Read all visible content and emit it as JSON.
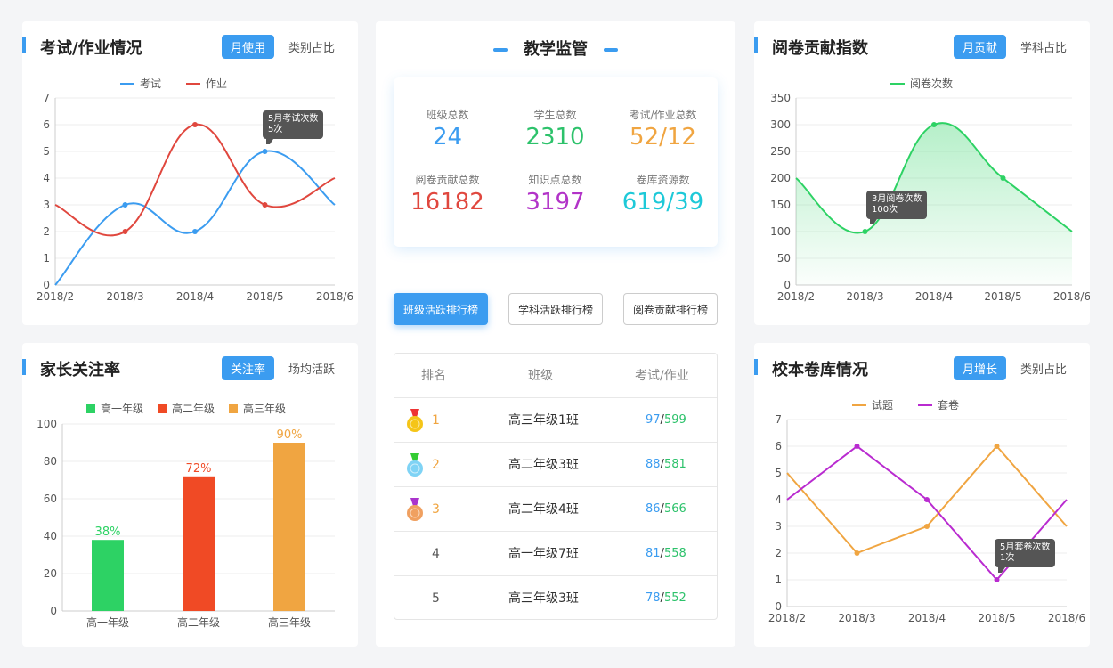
{
  "exam_card": {
    "title": "考试/作业情况",
    "tabs": [
      "月使用",
      "类别占比"
    ],
    "legend": [
      "考试",
      "作业"
    ],
    "colors": [
      "#3b9cf0",
      "#e0473e"
    ],
    "tooltip": [
      "5月考试次数",
      "5次"
    ],
    "chart_data": {
      "type": "line",
      "categories": [
        "2018/2",
        "2018/3",
        "2018/4",
        "2018/5",
        "2018/6"
      ],
      "y_ticks": [
        "0",
        "1",
        "2",
        "3",
        "4",
        "5",
        "6",
        "7"
      ],
      "ylim": [
        0,
        7
      ],
      "series": [
        {
          "name": "考试",
          "values": [
            0,
            3,
            2,
            5,
            3
          ]
        },
        {
          "name": "作业",
          "values": [
            3,
            2,
            6,
            3,
            4
          ]
        }
      ]
    }
  },
  "parent_card": {
    "title": "家长关注率",
    "tabs": [
      "关注率",
      "场均活跃"
    ],
    "legend": [
      "高一年级",
      "高二年级",
      "高三年级"
    ],
    "colors": [
      "#2dd264",
      "#f04a25",
      "#f0a541"
    ],
    "chart_data": {
      "type": "bar",
      "categories": [
        "高一年级",
        "高二年级",
        "高三年级"
      ],
      "values": [
        38,
        72,
        90
      ],
      "labels": [
        "38%",
        "72%",
        "90%"
      ],
      "y_ticks": [
        "0",
        "20",
        "40",
        "60",
        "80",
        "100"
      ],
      "ylim": [
        0,
        100
      ]
    }
  },
  "center": {
    "title": "教学监管",
    "stats": [
      {
        "label": "班级总数",
        "value": "24",
        "color": "#3b9cf0"
      },
      {
        "label": "学生总数",
        "value": "2310",
        "color": "#2dc26b"
      },
      {
        "label": "考试/作业总数",
        "value": "52/12",
        "color": "#f0a541"
      },
      {
        "label": "阅卷贡献总数",
        "value": "16182",
        "color": "#e0473e"
      },
      {
        "label": "知识点总数",
        "value": "3197",
        "color": "#b233c8"
      },
      {
        "label": "卷库资源数",
        "value": "619/39",
        "color": "#1ec9d8"
      }
    ],
    "rank_buttons": [
      "班级活跃排行榜",
      "学科活跃排行榜",
      "阅卷贡献排行榜"
    ],
    "table_headers": [
      "排名",
      "班级",
      "考试/作业"
    ],
    "rows": [
      {
        "rank": "1",
        "class": "高三年级1班",
        "exam": "97",
        "hw": "599"
      },
      {
        "rank": "2",
        "class": "高二年级3班",
        "exam": "88",
        "hw": "581"
      },
      {
        "rank": "3",
        "class": "高二年级4班",
        "exam": "86",
        "hw": "566"
      },
      {
        "rank": "4",
        "class": "高一年级7班",
        "exam": "81",
        "hw": "558"
      },
      {
        "rank": "5",
        "class": "高三年级3班",
        "exam": "78",
        "hw": "552"
      }
    ],
    "slash": "/"
  },
  "marking_card": {
    "title": "阅卷贡献指数",
    "tabs": [
      "月贡献",
      "学科占比"
    ],
    "legend": [
      "阅卷次数"
    ],
    "colors": [
      "#2dd264"
    ],
    "tooltip": [
      "3月阅卷次数",
      "100次"
    ],
    "chart_data": {
      "type": "area",
      "categories": [
        "2018/2",
        "2018/3",
        "2018/4",
        "2018/5",
        "2018/6"
      ],
      "y_ticks": [
        "0",
        "50",
        "100",
        "150",
        "200",
        "250",
        "300",
        "350"
      ],
      "ylim": [
        0,
        350
      ],
      "series": [
        {
          "name": "阅卷次数",
          "values": [
            200,
            100,
            300,
            200,
            100
          ]
        }
      ]
    }
  },
  "bank_card": {
    "title": "校本卷库情况",
    "tabs": [
      "月增长",
      "类别占比"
    ],
    "legend": [
      "试题",
      "套卷"
    ],
    "colors": [
      "#f0a541",
      "#b92bd0"
    ],
    "tooltip": [
      "5月套卷次数",
      "1次"
    ],
    "chart_data": {
      "type": "line",
      "categories": [
        "2018/2",
        "2018/3",
        "2018/4",
        "2018/5",
        "2018/6"
      ],
      "y_ticks": [
        "0",
        "1",
        "2",
        "3",
        "4",
        "5",
        "6",
        "7"
      ],
      "ylim": [
        0,
        7
      ],
      "series": [
        {
          "name": "试题",
          "values": [
            5,
            2,
            3,
            6,
            3
          ]
        },
        {
          "name": "套卷",
          "values": [
            4,
            6,
            4,
            1,
            4
          ]
        }
      ]
    }
  }
}
